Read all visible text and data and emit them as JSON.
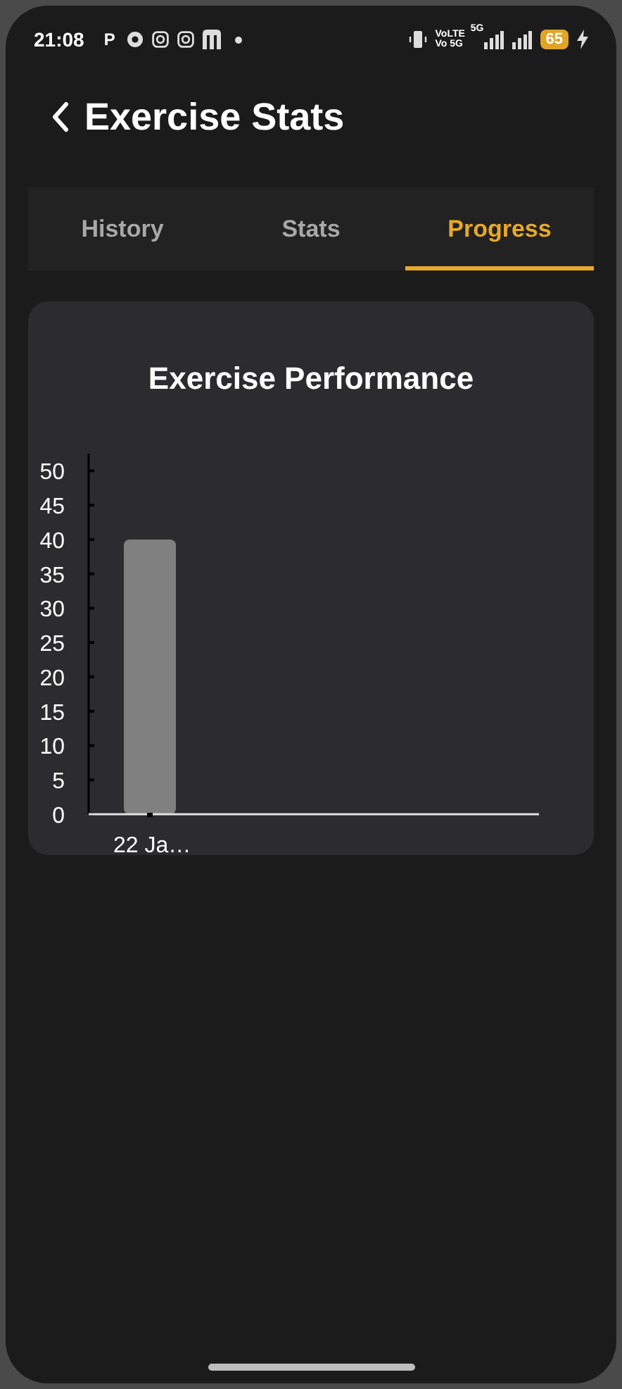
{
  "status_bar": {
    "time": "21:08",
    "app_letter": "P",
    "volte_top": "VoLTE",
    "volte_bottom": "Vo 5G",
    "network": "5G",
    "battery": "65"
  },
  "header": {
    "title": "Exercise Stats"
  },
  "tabs": [
    {
      "label": "History",
      "selected": false
    },
    {
      "label": "Stats",
      "selected": false
    },
    {
      "label": "Progress",
      "selected": true
    }
  ],
  "card": {
    "title": "Exercise Performance",
    "chart_data": {
      "type": "bar",
      "categories": [
        "22 Ja…"
      ],
      "series": [
        {
          "color": "#808080",
          "values": [
            40
          ]
        }
      ],
      "ylim": [
        0,
        52.5
      ],
      "yticks": [
        0,
        5,
        10,
        15,
        20,
        25,
        30,
        35,
        40,
        45,
        50
      ]
    }
  }
}
